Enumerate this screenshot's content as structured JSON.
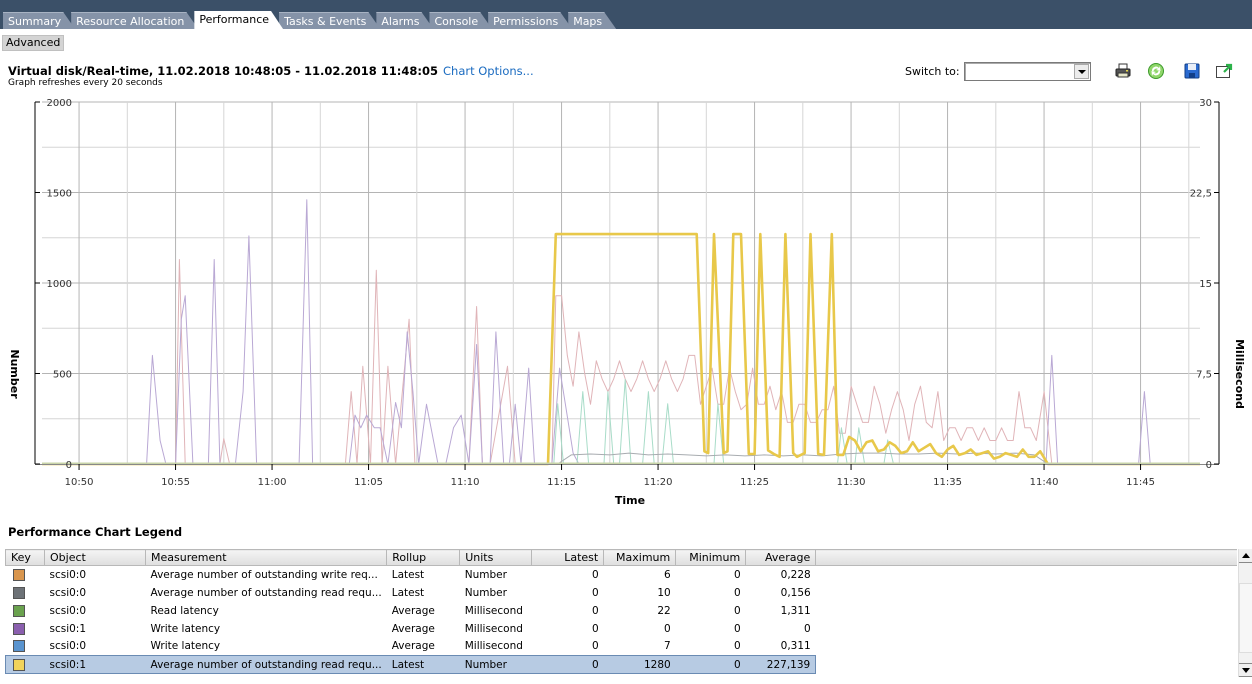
{
  "tabs": [
    {
      "label": "Summary",
      "active": false
    },
    {
      "label": "Resource Allocation",
      "active": false
    },
    {
      "label": "Performance",
      "active": true
    },
    {
      "label": "Tasks & Events",
      "active": false
    },
    {
      "label": "Alarms",
      "active": false
    },
    {
      "label": "Console",
      "active": false
    },
    {
      "label": "Permissions",
      "active": false
    },
    {
      "label": "Maps",
      "active": false
    }
  ],
  "toolbar": {
    "advanced_label": "Advanced",
    "switch_to_label": "Switch to:",
    "switch_to_value": "",
    "icons": [
      "print-icon",
      "refresh-icon",
      "save-icon",
      "popout-icon"
    ]
  },
  "header": {
    "title": "Virtual disk/Real-time, 11.02.2018 10:48:05 - 11.02.2018 11:48:05",
    "chart_options_link": "Chart Options...",
    "refresh_note": "Graph refreshes every 20 seconds"
  },
  "chart_data": {
    "type": "line",
    "title": "Virtual disk/Real-time, 11.02.2018 10:48:05 - 11.02.2018 11:48:05",
    "xlabel": "Time",
    "ylabel": "Number",
    "y2label": "Millisecond",
    "x_range_minutes": [
      48.08,
      108.08
    ],
    "x_ticks": [
      "10:50",
      "10:55",
      "11:00",
      "11:05",
      "11:10",
      "11:15",
      "11:20",
      "11:25",
      "11:30",
      "11:35",
      "11:40",
      "11:45"
    ],
    "x_tick_minutes": [
      50,
      55,
      60,
      65,
      70,
      75,
      80,
      85,
      90,
      95,
      100,
      105
    ],
    "ylim": [
      0,
      2000
    ],
    "y_ticks": [
      "0",
      "500",
      "1000",
      "1500",
      "2000"
    ],
    "y_tick_values": [
      0,
      500,
      1000,
      1500,
      2000
    ],
    "y2lim": [
      0,
      30
    ],
    "y2_ticks": [
      "0",
      "7,5",
      "15",
      "22,5",
      "30"
    ],
    "y2_tick_values": [
      0,
      7.5,
      15,
      22.5,
      30
    ],
    "grid": true,
    "series": [
      {
        "name": "scsi0:1 Average number of outstanding read requests",
        "color": "#e8c84a",
        "axis": "left",
        "x": [
          48.08,
          74.3,
          74.7,
          81.7,
          82.0,
          82.4,
          82.6,
          82.9,
          83.4,
          83.6,
          83.9,
          84.3,
          84.7,
          85.0,
          85.3,
          85.7,
          86.0,
          86.3,
          86.6,
          87.0,
          87.2,
          87.6,
          87.9,
          88.3,
          88.6,
          89.0,
          89.3,
          89.6,
          89.9,
          90.2,
          90.5,
          90.8,
          91.1,
          91.4,
          91.7,
          92.0,
          92.3,
          92.6,
          92.9,
          93.2,
          93.5,
          93.8,
          94.1,
          94.4,
          94.7,
          95.0,
          95.3,
          95.6,
          95.9,
          96.2,
          96.5,
          96.8,
          97.1,
          97.4,
          97.7,
          98.0,
          98.3,
          98.6,
          98.9,
          99.2,
          99.5,
          99.8,
          100.2,
          108.08
        ],
        "values": [
          0,
          0,
          1270,
          1270,
          1270,
          70,
          60,
          1270,
          60,
          70,
          1270,
          1270,
          55,
          55,
          1270,
          75,
          55,
          40,
          1270,
          60,
          40,
          60,
          1270,
          55,
          50,
          1270,
          50,
          50,
          150,
          130,
          70,
          120,
          130,
          70,
          80,
          120,
          100,
          60,
          70,
          120,
          70,
          90,
          110,
          60,
          40,
          80,
          100,
          50,
          60,
          80,
          50,
          60,
          70,
          30,
          40,
          60,
          50,
          40,
          80,
          40,
          40,
          70,
          0,
          0
        ]
      },
      {
        "name": "scsi0:0 Average number of outstanding write requests",
        "color": "#e0b4b8",
        "axis": "left",
        "x": [
          48.08,
          55.0,
          55.2,
          55.5,
          57.3,
          57.5,
          57.8,
          63.8,
          64.1,
          64.4,
          64.7,
          65.1,
          65.4,
          65.7,
          66.0,
          66.4,
          67.1,
          67.4,
          67.7,
          68.0,
          68.4,
          70.2,
          70.6,
          70.9,
          71.3,
          72.2,
          72.6,
          73.0,
          74.5,
          74.7,
          75.0,
          75.3,
          75.6,
          75.9,
          76.2,
          76.5,
          76.8,
          77.1,
          77.4,
          77.7,
          78.0,
          78.3,
          78.6,
          78.9,
          79.2,
          79.5,
          79.8,
          80.1,
          80.4,
          80.7,
          81.0,
          81.3,
          81.6,
          81.9,
          82.2,
          82.5,
          82.8,
          83.1,
          83.4,
          83.7,
          84.0,
          84.3,
          84.6,
          84.9,
          85.2,
          85.5,
          85.8,
          86.1,
          86.4,
          86.7,
          87.0,
          87.3,
          87.6,
          87.9,
          88.2,
          88.5,
          88.8,
          89.1,
          89.4,
          89.7,
          90.0,
          90.3,
          90.6,
          90.9,
          91.2,
          91.5,
          91.8,
          92.1,
          92.4,
          92.7,
          93.0,
          93.3,
          93.6,
          93.9,
          94.2,
          94.5,
          94.8,
          95.1,
          95.4,
          95.7,
          96.0,
          96.3,
          96.6,
          96.9,
          97.2,
          97.5,
          97.8,
          98.1,
          98.4,
          98.7,
          99.0,
          99.3,
          99.6,
          100.0,
          100.4,
          108.08
        ],
        "values": [
          0,
          0,
          1130,
          0,
          0,
          140,
          0,
          0,
          400,
          0,
          540,
          0,
          1070,
          0,
          540,
          0,
          800,
          0,
          0,
          0,
          0,
          0,
          870,
          0,
          0,
          540,
          0,
          0,
          0,
          930,
          930,
          600,
          430,
          730,
          500,
          330,
          570,
          470,
          400,
          470,
          570,
          470,
          400,
          470,
          570,
          470,
          400,
          470,
          570,
          470,
          400,
          470,
          600,
          600,
          330,
          430,
          530,
          330,
          330,
          530,
          400,
          300,
          330,
          530,
          330,
          330,
          430,
          300,
          400,
          230,
          230,
          330,
          330,
          230,
          230,
          300,
          300,
          430,
          170,
          170,
          430,
          330,
          230,
          230,
          430,
          330,
          170,
          300,
          400,
          300,
          130,
          330,
          430,
          230,
          200,
          400,
          130,
          200,
          200,
          130,
          200,
          200,
          130,
          200,
          130,
          130,
          200,
          130,
          130,
          400,
          200,
          200,
          130,
          400,
          0,
          0
        ]
      },
      {
        "name": "scsi0:1 Write latency",
        "color": "#b9a8d4",
        "axis": "left",
        "x": [
          48.08,
          53.5,
          53.8,
          54.2,
          54.5,
          55.0,
          55.3,
          55.5,
          55.9,
          56.7,
          57.0,
          57.3,
          58.1,
          58.5,
          58.8,
          59.2,
          61.4,
          61.8,
          62.1,
          64.0,
          64.3,
          64.6,
          64.9,
          65.3,
          65.6,
          66.0,
          66.4,
          66.7,
          67.0,
          67.3,
          67.6,
          68.0,
          68.6,
          69.0,
          69.4,
          69.8,
          70.2,
          70.6,
          70.9,
          71.3,
          71.6,
          72.0,
          72.3,
          72.6,
          72.9,
          73.3,
          73.6,
          73.9,
          74.2,
          74.5,
          74.9,
          75.2,
          75.6,
          75.9,
          76.2,
          100.1,
          100.4,
          100.7,
          104.9,
          105.2,
          105.5,
          108.08
        ],
        "values": [
          0,
          0,
          600,
          130,
          0,
          0,
          800,
          930,
          0,
          0,
          1130,
          0,
          0,
          400,
          1260,
          0,
          0,
          1460,
          0,
          0,
          270,
          200,
          270,
          200,
          200,
          0,
          340,
          200,
          730,
          400,
          0,
          330,
          0,
          0,
          200,
          270,
          0,
          660,
          0,
          0,
          730,
          0,
          0,
          330,
          0,
          530,
          0,
          0,
          0,
          0,
          530,
          330,
          60,
          0,
          0,
          0,
          600,
          0,
          0,
          400,
          0,
          0
        ]
      },
      {
        "name": "scsi0:0 Read latency",
        "color": "#a8dcc8",
        "axis": "right",
        "x": [
          48.08,
          74.6,
          74.8,
          75.1,
          75.8,
          76.1,
          76.4,
          77.2,
          77.4,
          77.7,
          78.0,
          78.3,
          78.6,
          79.2,
          79.5,
          79.8,
          80.2,
          80.5,
          80.8,
          82.9,
          83.1,
          83.4,
          89.3,
          89.5,
          89.8,
          90.2,
          90.4,
          90.7,
          91.7,
          91.9,
          92.2,
          108.08
        ],
        "values": [
          0,
          0,
          5,
          0,
          0,
          6,
          0,
          0,
          6,
          0,
          0,
          7,
          0,
          0,
          6,
          0,
          0,
          5,
          0,
          0,
          5,
          0,
          0,
          3,
          0,
          0,
          3,
          0,
          0,
          2,
          0,
          0
        ]
      },
      {
        "name": "scsi0:0 Average number of outstanding read requests",
        "color": "#a8acb0",
        "axis": "left",
        "x": [
          48.08,
          74.8,
          75.5,
          76.5,
          77.5,
          78.5,
          79.5,
          80.5,
          81.5,
          82.5,
          83.5,
          84.5,
          85.5,
          86.5,
          87.5,
          88.5,
          89.5,
          90.5,
          91.5,
          92.5,
          93.5,
          94.5,
          95.5,
          96.5,
          97.5,
          98.5,
          99.5,
          100.2,
          108.08
        ],
        "values": [
          0,
          0,
          50,
          55,
          50,
          60,
          50,
          55,
          50,
          45,
          50,
          45,
          50,
          45,
          50,
          45,
          55,
          60,
          60,
          55,
          55,
          60,
          55,
          60,
          55,
          60,
          50,
          0,
          0
        ]
      }
    ]
  },
  "legend": {
    "title": "Performance Chart Legend",
    "columns": [
      "Key",
      "Object",
      "Measurement",
      "Rollup",
      "Units",
      "Latest",
      "Maximum",
      "Minimum",
      "Average"
    ],
    "rows": [
      {
        "color": "#d9964e",
        "object": "scsi0:0",
        "measurement": "Average number of outstanding write req...",
        "rollup": "Latest",
        "units": "Number",
        "latest": "0",
        "maximum": "6",
        "minimum": "0",
        "average": "0,228",
        "selected": false
      },
      {
        "color": "#6d7277",
        "object": "scsi0:0",
        "measurement": "Average number of outstanding read requ...",
        "rollup": "Latest",
        "units": "Number",
        "latest": "0",
        "maximum": "10",
        "minimum": "0",
        "average": "0,156",
        "selected": false
      },
      {
        "color": "#6aa24e",
        "object": "scsi0:0",
        "measurement": "Read latency",
        "rollup": "Average",
        "units": "Millisecond",
        "latest": "0",
        "maximum": "22",
        "minimum": "0",
        "average": "1,311",
        "selected": false
      },
      {
        "color": "#8a5fae",
        "object": "scsi0:1",
        "measurement": "Write latency",
        "rollup": "Average",
        "units": "Millisecond",
        "latest": "0",
        "maximum": "0",
        "minimum": "0",
        "average": "0",
        "selected": false
      },
      {
        "color": "#5a94cf",
        "object": "scsi0:0",
        "measurement": "Write latency",
        "rollup": "Average",
        "units": "Millisecond",
        "latest": "0",
        "maximum": "7",
        "minimum": "0",
        "average": "0,311",
        "selected": false
      },
      {
        "color": "#f2d35a",
        "object": "scsi0:1",
        "measurement": "Average number of outstanding read requ...",
        "rollup": "Latest",
        "units": "Number",
        "latest": "0",
        "maximum": "1280",
        "minimum": "0",
        "average": "227,139",
        "selected": true
      }
    ]
  }
}
